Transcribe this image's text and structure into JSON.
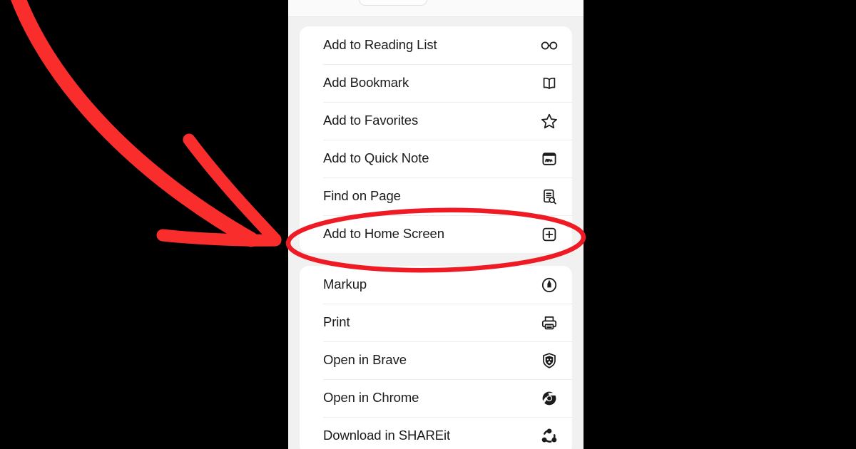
{
  "screen": {
    "device": "iPhone Safari share sheet",
    "background_color": "#000000",
    "sheet_background": "#f1f1f2",
    "card_color": "#ffffff",
    "text_color": "#1b1b1d",
    "divider_color": "#ededee"
  },
  "share_sheet": {
    "groups": [
      {
        "name": "primary-actions",
        "items": [
          {
            "label": "Add to Reading List",
            "icon": "glasses-icon"
          },
          {
            "label": "Add Bookmark",
            "icon": "open-book-icon"
          },
          {
            "label": "Add to Favorites",
            "icon": "star-outline-icon"
          },
          {
            "label": "Add to Quick Note",
            "icon": "quick-note-icon"
          },
          {
            "label": "Find on Page",
            "icon": "find-on-page-icon"
          },
          {
            "label": "Add to Home Screen",
            "icon": "plus-square-icon"
          }
        ]
      },
      {
        "name": "secondary-actions",
        "items": [
          {
            "label": "Markup",
            "icon": "markup-pen-icon"
          },
          {
            "label": "Print",
            "icon": "printer-icon"
          },
          {
            "label": "Open in Brave",
            "icon": "brave-lion-icon"
          },
          {
            "label": "Open in Chrome",
            "icon": "chrome-icon"
          },
          {
            "label": "Download in SHAREit",
            "icon": "shareit-icon"
          }
        ]
      }
    ]
  },
  "annotations": {
    "color": "#fa2d2d",
    "arrow": {
      "name": "hand-drawn-arrow",
      "description": "curved stroke from top-left sweeping down-right with a V arrowhead pointing at the highlighted row"
    },
    "highlight_ellipse": {
      "name": "highlight-ellipse",
      "target_label": "Add to Home Screen"
    }
  }
}
